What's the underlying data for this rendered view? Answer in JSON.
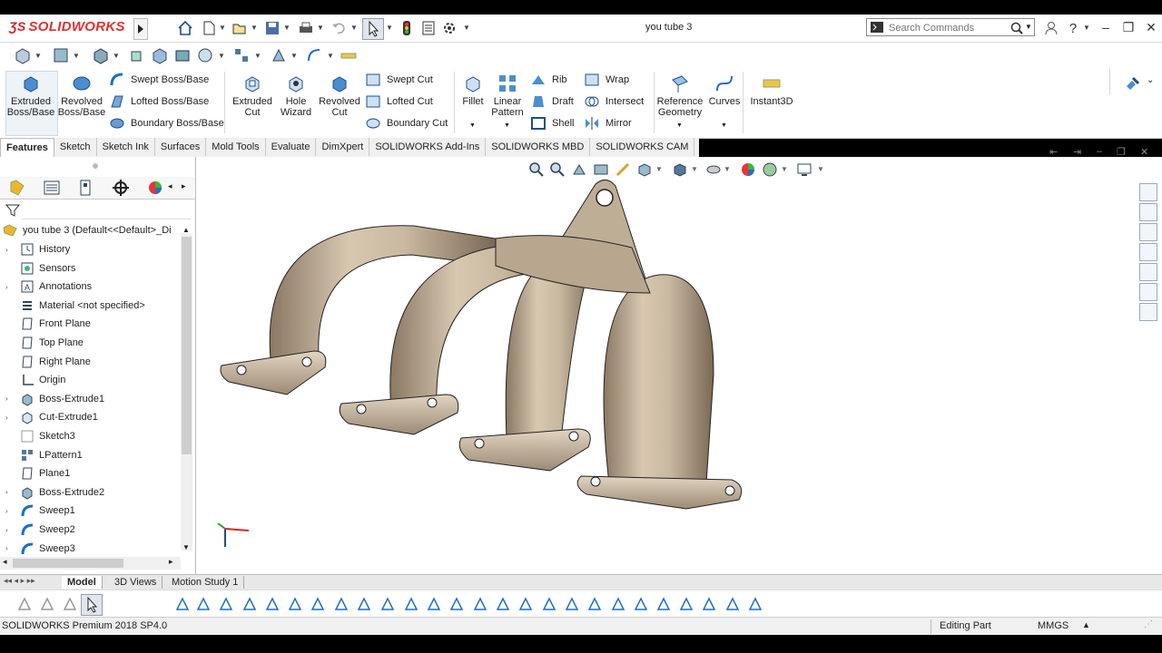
{
  "app": {
    "logo_text": "SOLIDWORKS",
    "document_title": "you tube 3"
  },
  "search": {
    "placeholder": "Search Commands"
  },
  "ribbon": {
    "extruded_boss": "Extruded Boss/Base",
    "revolved_boss": "Revolved Boss/Base",
    "swept_boss": "Swept Boss/Base",
    "lofted_boss": "Lofted Boss/Base",
    "boundary_boss": "Boundary Boss/Base",
    "extruded_cut": "Extruded Cut",
    "hole_wizard": "Hole Wizard",
    "revolved_cut": "Revolved Cut",
    "swept_cut": "Swept Cut",
    "lofted_cut": "Lofted Cut",
    "boundary_cut": "Boundary Cut",
    "fillet": "Fillet",
    "linear_pattern": "Linear Pattern",
    "rib": "Rib",
    "draft": "Draft",
    "shell": "Shell",
    "wrap": "Wrap",
    "intersect": "Intersect",
    "mirror": "Mirror",
    "reference_geometry": "Reference Geometry",
    "curves": "Curves",
    "instant3d": "Instant3D"
  },
  "command_tabs": [
    "Features",
    "Sketch",
    "Sketch Ink",
    "Surfaces",
    "Mold Tools",
    "Evaluate",
    "DimXpert",
    "SOLIDWORKS Add-Ins",
    "SOLIDWORKS MBD",
    "SOLIDWORKS CAM"
  ],
  "tree": {
    "root": "you tube 3  (Default<<Default>_Di",
    "items": [
      {
        "label": "History",
        "icon": "history-icon",
        "expandable": true
      },
      {
        "label": "Sensors",
        "icon": "sensors-icon",
        "expandable": false
      },
      {
        "label": "Annotations",
        "icon": "annotations-icon",
        "expandable": true
      },
      {
        "label": "Material <not specified>",
        "icon": "material-icon",
        "expandable": false
      },
      {
        "label": "Front Plane",
        "icon": "plane-icon",
        "expandable": false
      },
      {
        "label": "Top Plane",
        "icon": "plane-icon",
        "expandable": false
      },
      {
        "label": "Right Plane",
        "icon": "plane-icon",
        "expandable": false
      },
      {
        "label": "Origin",
        "icon": "origin-icon",
        "expandable": false
      },
      {
        "label": "Boss-Extrude1",
        "icon": "extrude-icon",
        "expandable": true
      },
      {
        "label": "Cut-Extrude1",
        "icon": "cut-icon",
        "expandable": true
      },
      {
        "label": "Sketch3",
        "icon": "sketch-icon",
        "expandable": false
      },
      {
        "label": "LPattern1",
        "icon": "pattern-icon",
        "expandable": false
      },
      {
        "label": "Plane1",
        "icon": "plane-icon",
        "expandable": false
      },
      {
        "label": "Boss-Extrude2",
        "icon": "extrude-icon",
        "expandable": true
      },
      {
        "label": "Sweep1",
        "icon": "sweep-icon",
        "expandable": true
      },
      {
        "label": "Sweep2",
        "icon": "sweep-icon",
        "expandable": true
      },
      {
        "label": "Sweep3",
        "icon": "sweep-icon",
        "expandable": true
      }
    ]
  },
  "bottom_tabs": [
    "Model",
    "3D Views",
    "Motion Study 1"
  ],
  "status": {
    "product": "SOLIDWORKS Premium 2018 SP4.0",
    "mode": "Editing Part",
    "units": "MMGS"
  },
  "colors": {
    "part_surface": "#c9b8a0",
    "logo_red": "#d2232a",
    "accent_blue": "#1c6fc4"
  }
}
